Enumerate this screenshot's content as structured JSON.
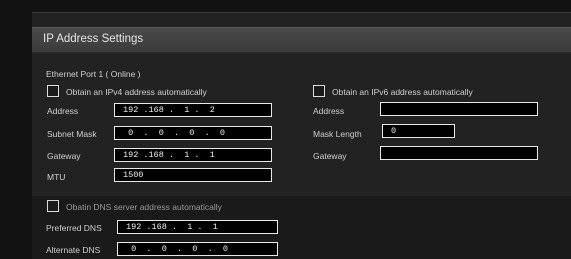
{
  "panel": {
    "title": "IP Address Settings"
  },
  "ethernet": {
    "port_label": "Ethernet Port 1 ( Online )",
    "ipv4": {
      "auto_label": "Obtain an IPv4 address automatically",
      "auto_checked": false,
      "address_label": "Address",
      "address_value": "192 .168 .  1 .  2",
      "subnet_label": "Subnet Mask",
      "subnet_value": " 0  .  0  .  0  .  0",
      "gateway_label": "Gateway",
      "gateway_value": "192 .168 .  1 .  1",
      "mtu_label": "MTU",
      "mtu_value": "1500"
    },
    "ipv6": {
      "auto_label": "Obtain an IPv6 address automatically",
      "auto_checked": false,
      "address_label": "Address",
      "address_value": "",
      "mask_label": "Mask Length",
      "mask_value": "0",
      "gateway_label": "Gateway",
      "gateway_value": ""
    }
  },
  "dns": {
    "auto_label": "Obatin DNS server address automatically",
    "auto_checked": false,
    "preferred_label": "Preferred DNS",
    "preferred_value": "192 .168 .  1 .  1",
    "alternate_label": "Alternate DNS",
    "alternate_value": " 0  .  0  .  0  .  0"
  }
}
